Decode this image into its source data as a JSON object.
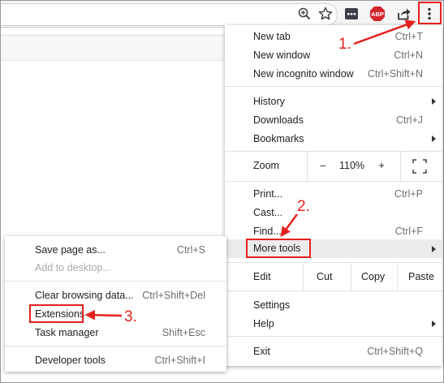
{
  "toolbar": {
    "icons": [
      "zoom-icon",
      "bookmark-star-icon",
      "extension-icon",
      "adblock-plus-icon",
      "share-icon",
      "chrome-menu-icon"
    ],
    "abp_label": "ABP",
    "colors": {
      "abp": "#d4232b",
      "annotation": "#e5211d"
    }
  },
  "main_menu": {
    "new_tab": {
      "label": "New tab",
      "shortcut": "Ctrl+T"
    },
    "new_window": {
      "label": "New window",
      "shortcut": "Ctrl+N"
    },
    "new_incognito": {
      "label": "New incognito window",
      "shortcut": "Ctrl+Shift+N"
    },
    "history": {
      "label": "History"
    },
    "downloads": {
      "label": "Downloads",
      "shortcut": "Ctrl+J"
    },
    "bookmarks": {
      "label": "Bookmarks"
    },
    "zoom": {
      "label": "Zoom",
      "minus": "–",
      "level": "110%",
      "plus": "+"
    },
    "print": {
      "label": "Print...",
      "shortcut": "Ctrl+P"
    },
    "cast": {
      "label": "Cast..."
    },
    "find": {
      "label": "Find...",
      "shortcut": "Ctrl+F"
    },
    "more_tools": {
      "label": "More tools"
    },
    "edit": {
      "label": "Edit",
      "cut": "Cut",
      "copy": "Copy",
      "paste": "Paste"
    },
    "settings": {
      "label": "Settings"
    },
    "help": {
      "label": "Help"
    },
    "exit": {
      "label": "Exit",
      "shortcut": "Ctrl+Shift+Q"
    }
  },
  "sub_menu": {
    "save_page": {
      "label": "Save page as...",
      "shortcut": "Ctrl+S"
    },
    "add_desktop": {
      "label": "Add to desktop..."
    },
    "clear_data": {
      "label": "Clear browsing data...",
      "shortcut": "Ctrl+Shift+Del"
    },
    "extensions": {
      "label": "Extensions"
    },
    "task_manager": {
      "label": "Task manager",
      "shortcut": "Shift+Esc"
    },
    "dev_tools": {
      "label": "Developer tools",
      "shortcut": "Ctrl+Shift+I"
    }
  },
  "annotations": {
    "step1": "1.",
    "step2": "2.",
    "step3": "3."
  }
}
